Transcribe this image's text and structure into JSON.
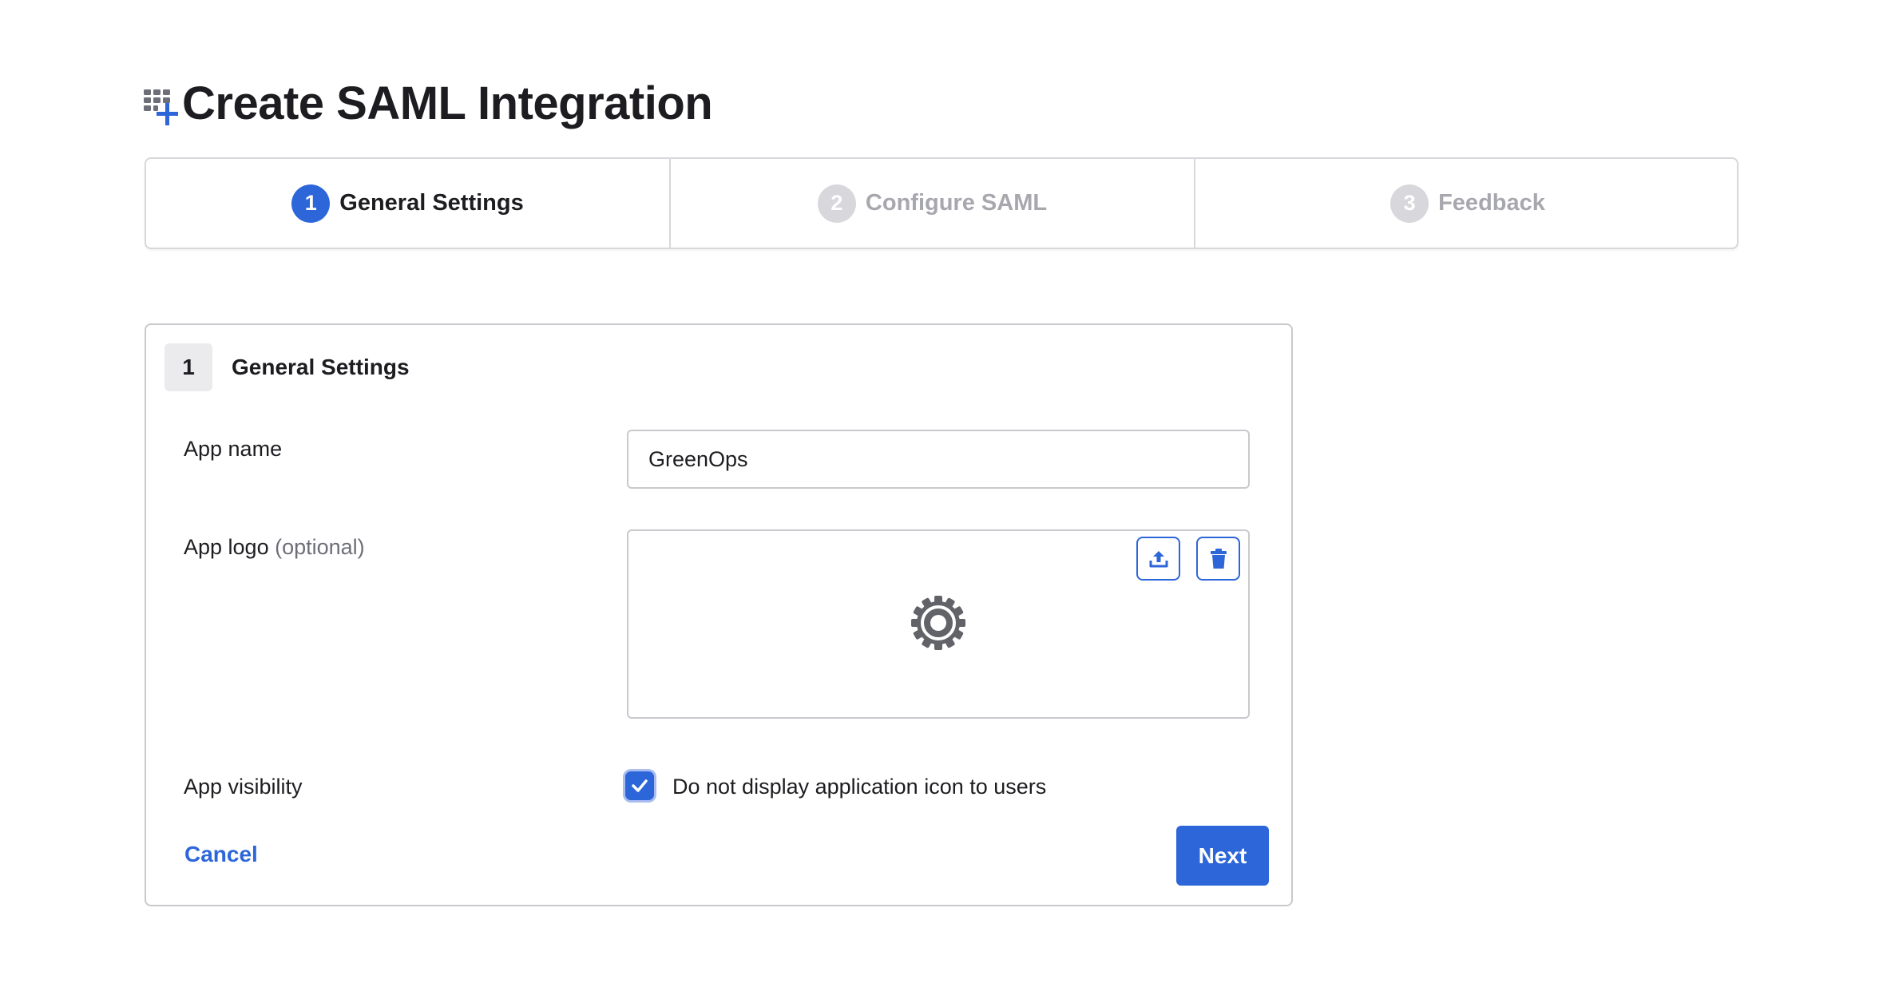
{
  "page": {
    "title": "Create SAML Integration",
    "title_icon": "app-grid-add-icon"
  },
  "stepper": {
    "steps": [
      {
        "number": "1",
        "label": "General Settings",
        "state": "active"
      },
      {
        "number": "2",
        "label": "Configure SAML",
        "state": "inactive"
      },
      {
        "number": "3",
        "label": "Feedback",
        "state": "inactive"
      }
    ]
  },
  "form": {
    "section_number": "1",
    "section_title": "General Settings",
    "app_name": {
      "label": "App name",
      "value": "GreenOps"
    },
    "app_logo": {
      "label": "App logo",
      "optional_text": "(optional)",
      "placeholder_icon": "gear-icon",
      "upload_icon": "upload-icon",
      "delete_icon": "trash-icon"
    },
    "app_visibility": {
      "label": "App visibility",
      "checkbox_label": "Do not display application icon to users",
      "checked": true
    },
    "cancel_label": "Cancel",
    "next_label": "Next"
  },
  "colors": {
    "primary": "#2d66d9",
    "text": "#1d1d21",
    "muted": "#a7a7ae",
    "border": "#c9c9ce"
  }
}
